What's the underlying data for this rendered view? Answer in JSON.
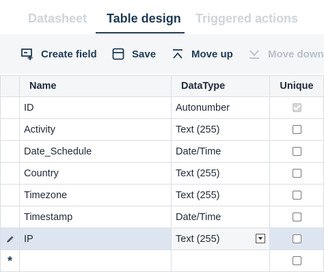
{
  "tabs": [
    {
      "label": "Datasheet",
      "active": false
    },
    {
      "label": "Table design",
      "active": true
    },
    {
      "label": "Triggered actions",
      "active": false
    }
  ],
  "toolbar": {
    "create_field": "Create field",
    "save": "Save",
    "move_up": "Move up",
    "move_down": "Move down"
  },
  "columns": {
    "name": "Name",
    "datatype": "DataType",
    "unique": "Unique"
  },
  "rows": [
    {
      "name": "ID",
      "datatype": "Autonumber",
      "unique": true,
      "unique_disabled": true
    },
    {
      "name": "Activity",
      "datatype": "Text (255)",
      "unique": false
    },
    {
      "name": "Date_Schedule",
      "datatype": "Date/Time",
      "unique": false
    },
    {
      "name": "Country",
      "datatype": "Text (255)",
      "unique": false
    },
    {
      "name": "Timezone",
      "datatype": "Text (255)",
      "unique": false
    },
    {
      "name": "Timestamp",
      "datatype": "Date/Time",
      "unique": false
    },
    {
      "name": "IP",
      "datatype": "Text (255)",
      "unique": false,
      "editing": true
    }
  ],
  "new_row_marker": "*",
  "colors": {
    "accent": "#1e3a53",
    "inactive_tab": "#cfd5db",
    "toolbar_bg": "#f4f6f8",
    "selected_row": "#dde6f0",
    "grid_line": "#d9dde1"
  },
  "icons": {
    "create_field": "add-field-icon",
    "save": "save-icon",
    "move_up": "move-up-icon",
    "move_down": "move-down-icon",
    "edit_row": "pencil-icon"
  }
}
